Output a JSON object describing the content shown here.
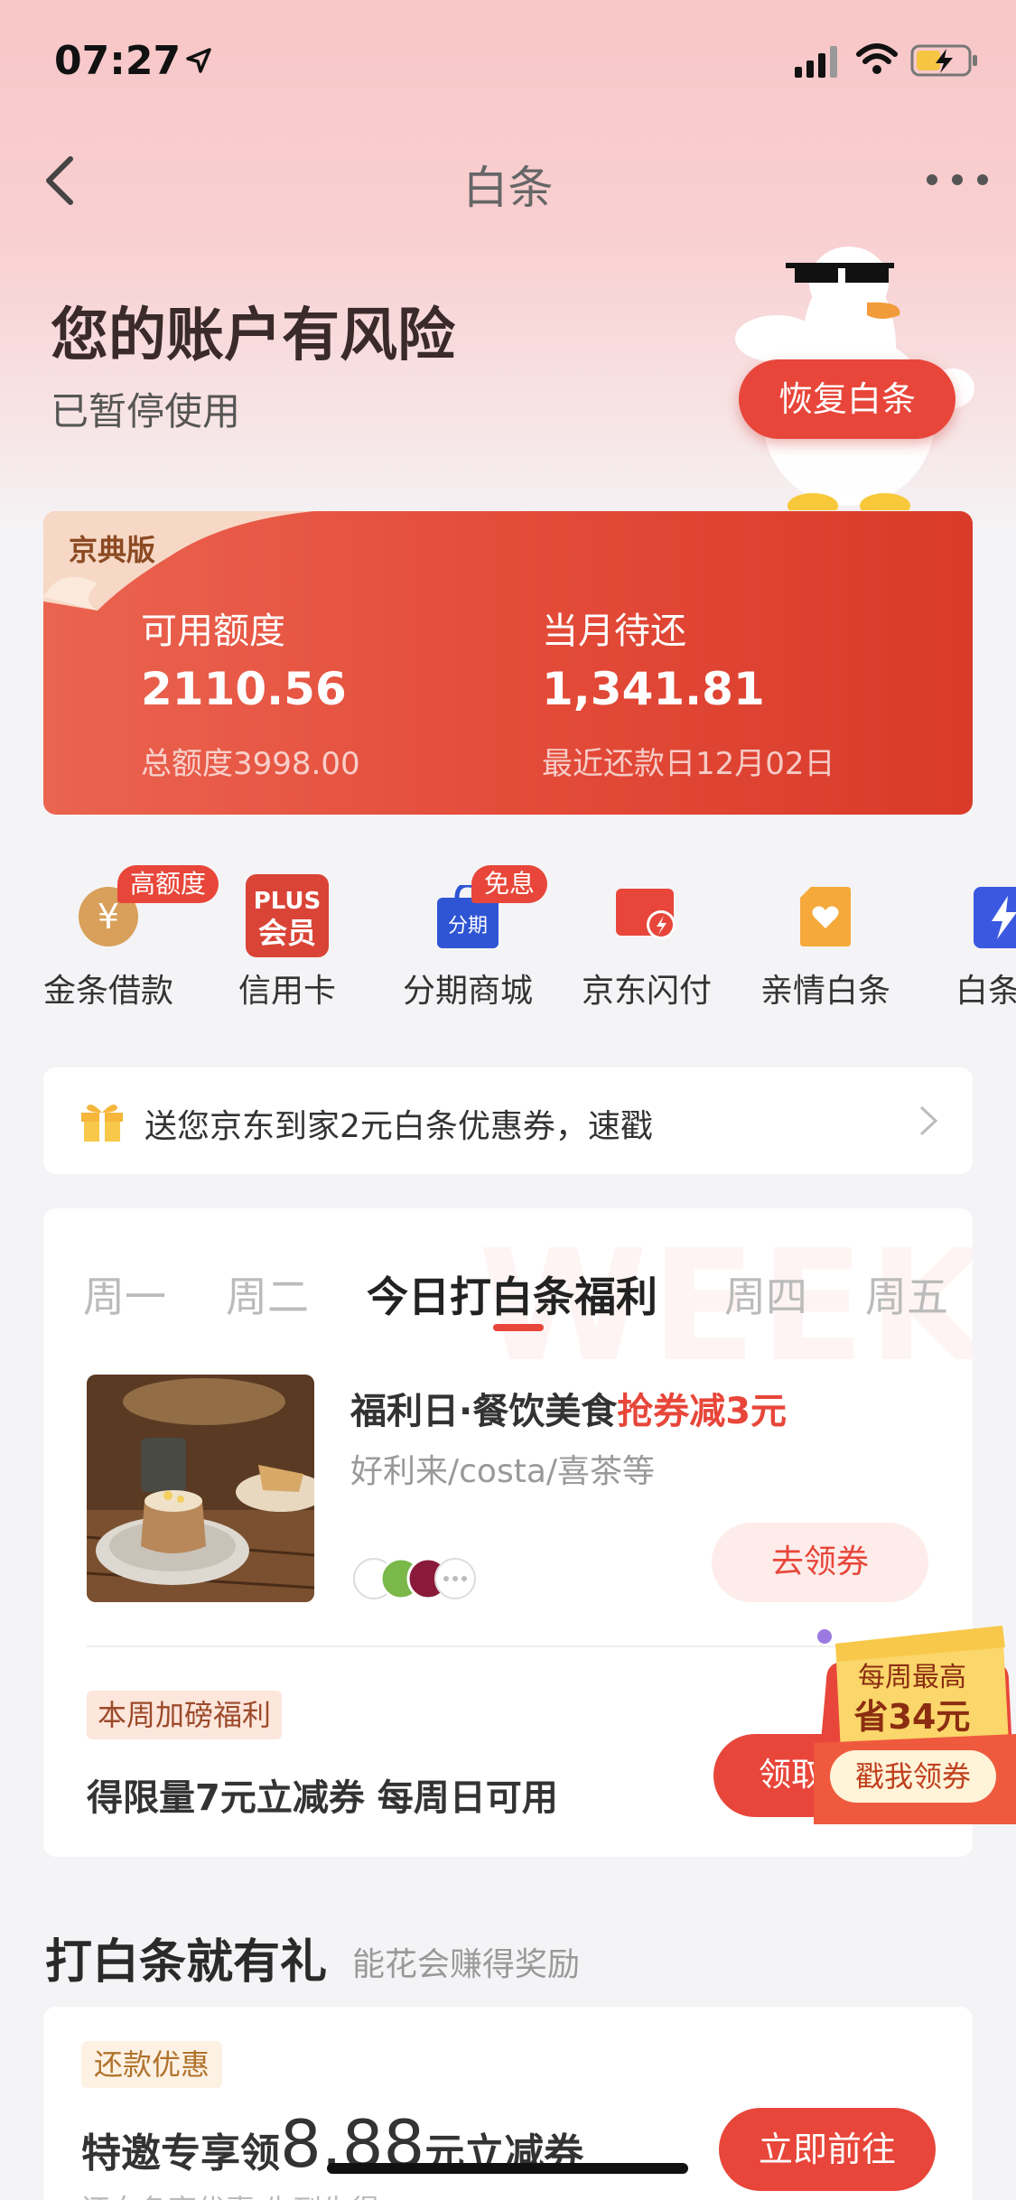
{
  "status_bar": {
    "time": "07:27"
  },
  "nav": {
    "title": "白条"
  },
  "account": {
    "title": "您的账户有风险",
    "subtitle": "已暂停使用",
    "restore_button": "恢复白条"
  },
  "credit_card": {
    "badge": "京典版",
    "available_label": "可用额度",
    "available_value": "2110.56",
    "total_note": "总额度3998.00",
    "due_label": "当月待还",
    "due_value": "1,341.81",
    "due_note": "最近还款日12月02日"
  },
  "quick_entries": [
    {
      "label": "金条借款",
      "badge": "高额度",
      "icon": "yuan-coin-icon"
    },
    {
      "label": "信用卡",
      "icon_text_1": "PLUS",
      "icon_text_2": "会员",
      "icon": "plus-member-icon"
    },
    {
      "label": "分期商城",
      "badge": "免息",
      "icon_text": "分期",
      "icon": "shopping-bag-icon"
    },
    {
      "label": "京东闪付",
      "icon": "flash-pay-icon"
    },
    {
      "label": "亲情白条",
      "icon": "heart-card-icon"
    },
    {
      "label": "白条闪",
      "icon": "lightning-icon"
    }
  ],
  "promo": {
    "text": "送您京东到家2元白条优惠券，速戳"
  },
  "welfare": {
    "watermark": "WEEK",
    "tabs": [
      "周一",
      "周二",
      "今日打白条福利",
      "周四",
      "周五"
    ],
    "active_tab": 2,
    "item_title_prefix": "福利日·餐饮美食",
    "item_title_highlight": "抢券减3元",
    "item_subtitle": "好利来/costa/喜茶等",
    "item_button": "去领券",
    "weekly_tag": "本周加磅福利",
    "weekly_text": "得限量7元立减券 每周日可用",
    "weekly_button": "领取"
  },
  "float_badge": {
    "line1": "每周最高",
    "line2": "省34元",
    "button": "戳我领券"
  },
  "gift_section": {
    "title": "打白条就有礼",
    "subtitle": "能花会赚得奖励"
  },
  "repay_card": {
    "tag": "还款优惠",
    "text_prefix": "特邀专享领",
    "amount": "8.88",
    "text_suffix": "元立减券",
    "sub": "还白条享优惠 先到先得",
    "button": "立即前往"
  },
  "colors": {
    "accent": "#e8463a",
    "header_bg": "#f8c6c7"
  }
}
